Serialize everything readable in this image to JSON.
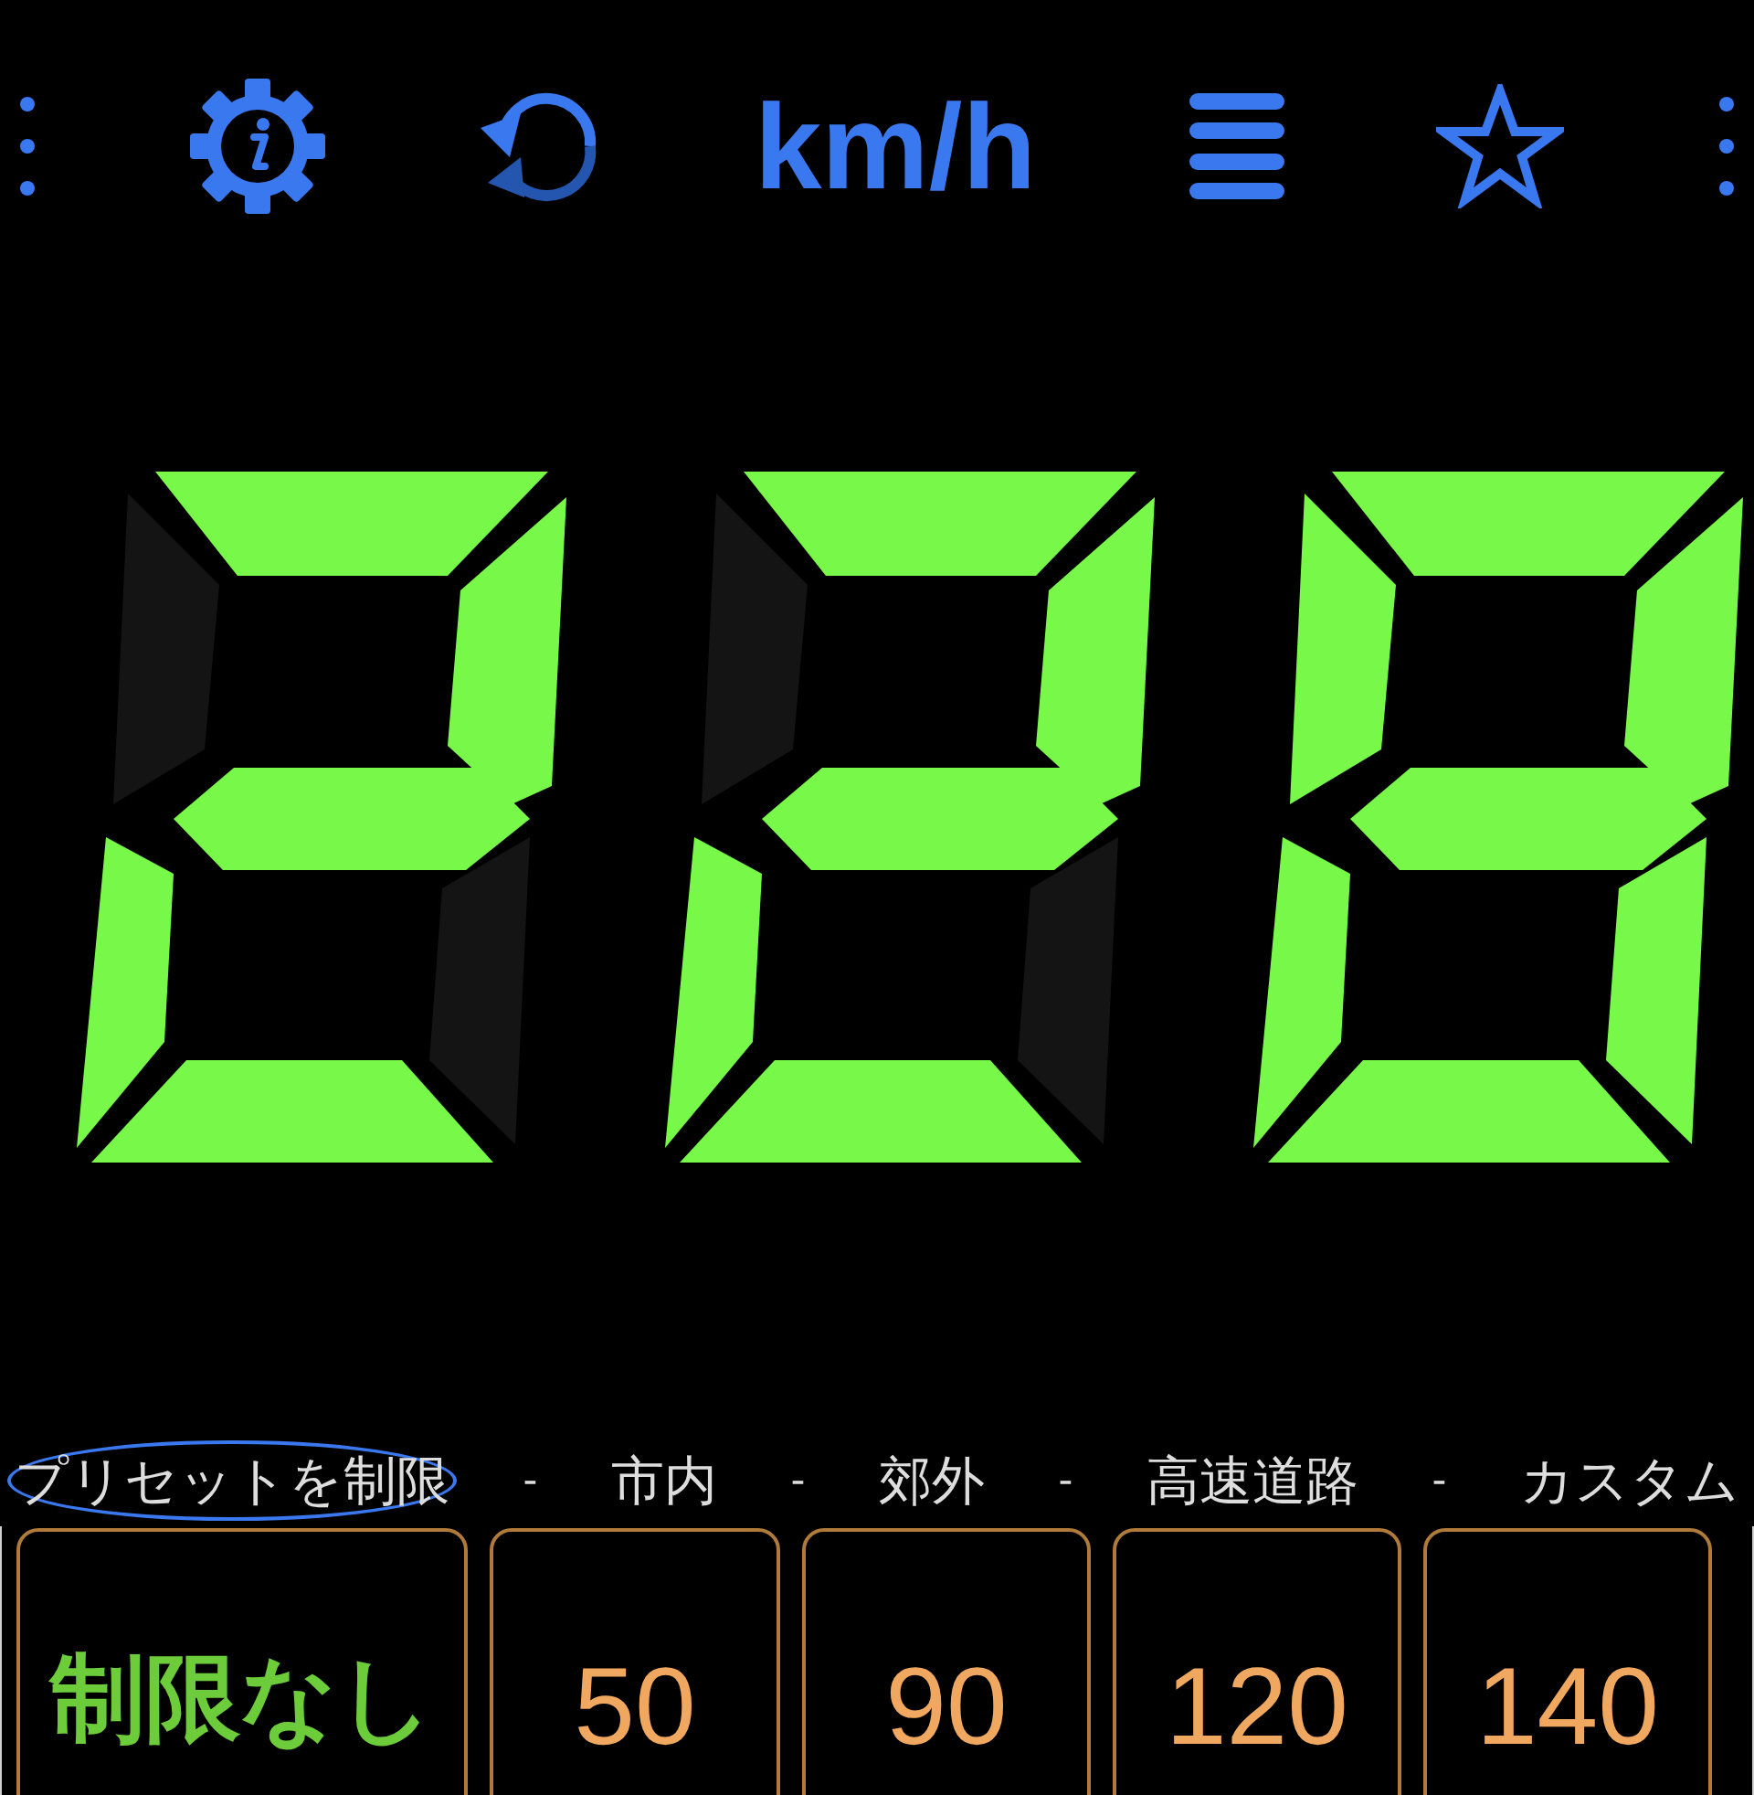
{
  "toolbar": {
    "unit": "km/h"
  },
  "display": {
    "digits": [
      {
        "lit": [
          true,
          true,
          false,
          true,
          true,
          false,
          true
        ]
      },
      {
        "lit": [
          true,
          true,
          false,
          true,
          true,
          false,
          true
        ]
      },
      {
        "lit": [
          true,
          true,
          true,
          true,
          true,
          true,
          true
        ]
      }
    ]
  },
  "preset_tabs": [
    {
      "label": "プリセットを制限",
      "selected": true
    },
    {
      "label": "市内",
      "selected": false
    },
    {
      "label": "郊外",
      "selected": false
    },
    {
      "label": "高速道路",
      "selected": false
    },
    {
      "label": "カスタム",
      "selected": false
    }
  ],
  "tab_separators": [
    "-",
    "-",
    "-",
    "-"
  ],
  "limit_cards": [
    {
      "value": "制限なし",
      "kind": "none"
    },
    {
      "value": "50",
      "kind": "number"
    },
    {
      "value": "90",
      "kind": "number"
    },
    {
      "value": "120",
      "kind": "number"
    },
    {
      "value": "140",
      "kind": "number"
    }
  ]
}
